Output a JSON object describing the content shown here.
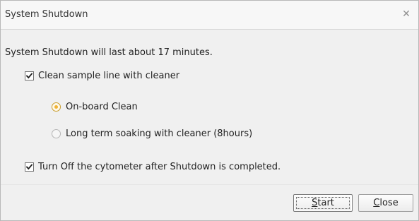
{
  "window": {
    "title": "System Shutdown"
  },
  "message": "System Shutdown will last about 17 minutes.",
  "options": {
    "clean_sample_line": {
      "label": "Clean sample line with cleaner",
      "checked": true
    },
    "cleaning_methods": [
      {
        "label": "On-board Clean",
        "selected": true
      },
      {
        "label": "Long term soaking with cleaner (8hours)",
        "selected": false
      }
    ],
    "turn_off_cytometer": {
      "label": "Turn Off the cytometer after Shutdown is completed.",
      "checked": true
    }
  },
  "buttons": {
    "start": {
      "label": "Start",
      "mnemonic": "S",
      "rest": "tart"
    },
    "close": {
      "label": "Close",
      "mnemonic": "C",
      "rest": "lose"
    }
  },
  "icons": {
    "close": "close-icon",
    "checkbox": "check-icon",
    "radio": "radio-icon"
  },
  "colors": {
    "selected_radio": "#f0b334",
    "selected_radio_border": "#c89d2d"
  }
}
